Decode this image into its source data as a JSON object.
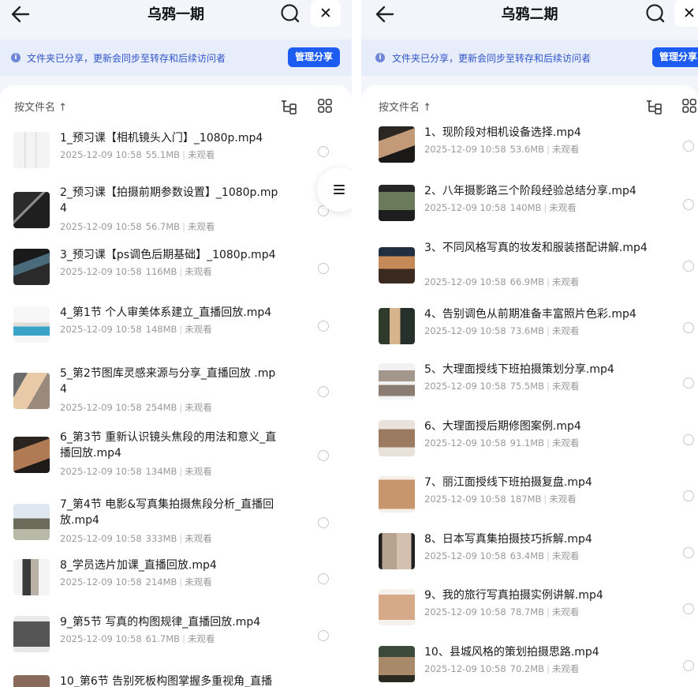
{
  "colors": {
    "accent": "#1d5cf0",
    "banner_bg": "#e8edfb",
    "banner_text": "#2f54c8",
    "meta_text": "#9a9a9a"
  },
  "left": {
    "title": "乌鸦一期",
    "share_notice": "文件夹已分享，更新会同步至转存和后续访问者",
    "manage_label": "管理分享",
    "sort_label": "按文件名 ↑",
    "files": [
      {
        "name": "1_预习课【相机镜头入门】_1080p.mp4",
        "date": "2025-12-09 10:58",
        "size": "55.1MB",
        "status": "未观看"
      },
      {
        "name": "2_预习课【拍摄前期参数设置】_1080p.mp4",
        "date": "2025-12-09 10:58",
        "size": "56.7MB",
        "status": "未观看"
      },
      {
        "name": "3_预习课【ps调色后期基础】_1080p.mp4",
        "date": "2025-12-09 10:58",
        "size": "116MB",
        "status": "未观看"
      },
      {
        "name": "4_第1节 个人审美体系建立_直播回放.mp4",
        "date": "2025-12-09 10:58",
        "size": "148MB",
        "status": "未观看"
      },
      {
        "name": "5_第2节图库灵感来源与分享_直播回放 .mp4",
        "date": "2025-12-09 10:58",
        "size": "254MB",
        "status": "未观看"
      },
      {
        "name": "6_第3节 重新认识镜头焦段的用法和意义_直播回放.mp4",
        "date": "2025-12-09 10:58",
        "size": "134MB",
        "status": "未观看"
      },
      {
        "name": "7_第4节 电影&写真集拍摄焦段分析_直播回放.mp4",
        "date": "2025-12-09 10:58",
        "size": "333MB",
        "status": "未观看"
      },
      {
        "name": "8_学员选片加课_直播回放.mp4",
        "date": "2025-12-09 10:58",
        "size": "214MB",
        "status": "未观看"
      },
      {
        "name": "9_第5节 写真的构图规律_直播回放.mp4",
        "date": "2025-12-09 10:58",
        "size": "61.7MB",
        "status": "未观看"
      },
      {
        "name": "10_第6节 告别死板构图掌握多重视角_直播",
        "date": "",
        "size": "",
        "status": ""
      }
    ]
  },
  "right": {
    "title": "乌鸦二期",
    "share_notice": "文件夹已分享，更新会同步至转存和后续访问者",
    "manage_label": "管理分享",
    "sort_label": "按文件名 ↑",
    "files": [
      {
        "name": "1、现阶段对相机设备选择.mp4",
        "date": "2025-12-09 10:58",
        "size": "53.6MB",
        "status": "未观看"
      },
      {
        "name": "2、八年摄影路三个阶段经验总结分享.mp4",
        "date": "2025-12-09 10:58",
        "size": "140MB",
        "status": "未观看"
      },
      {
        "name": "3、不同风格写真的妆发和服装搭配讲解.mp4",
        "date": "2025-12-09 10:58",
        "size": "66.9MB",
        "status": "未观看"
      },
      {
        "name": "4、告别调色从前期准备丰富照片色彩.mp4",
        "date": "2025-12-09 10:58",
        "size": "73.6MB",
        "status": "未观看"
      },
      {
        "name": "5、大理面授线下班拍摄策划分享.mp4",
        "date": "2025-12-09 10:58",
        "size": "75.5MB",
        "status": "未观看"
      },
      {
        "name": "6、大理面授后期修图案例.mp4",
        "date": "2025-12-09 10:58",
        "size": "91.1MB",
        "status": "未观看"
      },
      {
        "name": "7、丽江面授线下班拍摄复盘.mp4",
        "date": "2025-12-09 10:58",
        "size": "187MB",
        "status": "未观看"
      },
      {
        "name": "8、日本写真集拍摄技巧拆解.mp4",
        "date": "2025-12-09 10:58",
        "size": "63.4MB",
        "status": "未观看"
      },
      {
        "name": "9、我的旅行写真拍摄实例讲解.mp4",
        "date": "2025-12-09 10:58",
        "size": "78.7MB",
        "status": "未观看"
      },
      {
        "name": "10、县城风格的策划拍摄思路.mp4",
        "date": "2025-12-09 10:58",
        "size": "70.2MB",
        "status": "未观看"
      }
    ]
  }
}
